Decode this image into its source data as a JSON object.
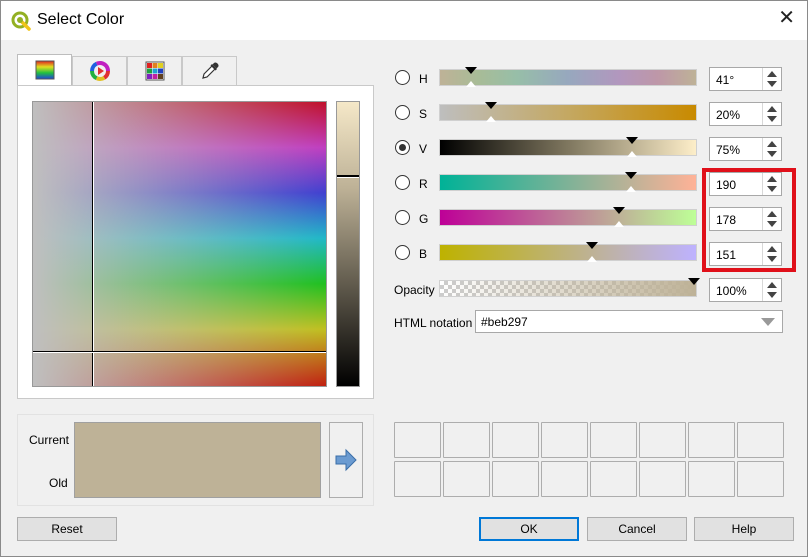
{
  "window": {
    "title": "Select Color",
    "close_glyph": "✕"
  },
  "tabs": [
    {
      "name": "color-ramp-tab",
      "icon": "color-ramp-icon"
    },
    {
      "name": "color-wheel-tab",
      "icon": "color-wheel-icon"
    },
    {
      "name": "swatch-grid-tab",
      "icon": "swatch-grid-icon"
    },
    {
      "name": "color-picker-tab",
      "icon": "eyedropper-icon"
    }
  ],
  "channels": [
    {
      "key": "h",
      "label": "H",
      "value": "41°",
      "level": 0.12,
      "selected": false
    },
    {
      "key": "s",
      "label": "S",
      "value": "20%",
      "level": 0.2,
      "selected": false
    },
    {
      "key": "v",
      "label": "V",
      "value": "75%",
      "level": 0.75,
      "selected": true
    },
    {
      "key": "r",
      "label": "R",
      "value": "190",
      "level": 0.745,
      "selected": false
    },
    {
      "key": "g",
      "label": "G",
      "value": "178",
      "level": 0.698,
      "selected": false
    },
    {
      "key": "b",
      "label": "B",
      "value": "151",
      "level": 0.592,
      "selected": false
    }
  ],
  "opacity": {
    "label": "Opacity",
    "value": "100%",
    "level": 1.0
  },
  "html_notation": {
    "label": "HTML notation",
    "value": "#beb297"
  },
  "preview": {
    "current_label": "Current",
    "old_label": "Old",
    "color": "#beb297"
  },
  "buttons": {
    "reset": "Reset",
    "ok": "OK",
    "cancel": "Cancel",
    "help": "Help"
  },
  "colors": {
    "accent": "#0078d7",
    "highlight": "#e0101a",
    "current": "#beb297"
  }
}
